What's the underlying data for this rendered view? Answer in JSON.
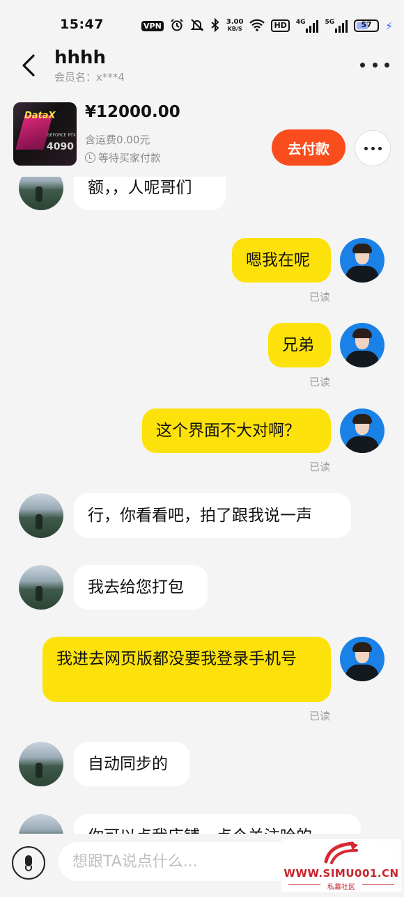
{
  "status_bar": {
    "time": "15:47",
    "vpn": "VPN",
    "speed_value": "3.00",
    "speed_unit": "KB/S",
    "hd": "HD",
    "net1": "4G",
    "net2": "5G",
    "battery": "57"
  },
  "header": {
    "title": "hhhh",
    "subtitle": "会员名：x***4"
  },
  "product": {
    "thumb_brand": "DataX",
    "thumb_gpu_text": "GEFORCE RTX",
    "thumb_model": "4090",
    "price": "¥12000.00",
    "shipping": "含运费0.00元",
    "status": "等待买家付款",
    "pay_button": "去付款"
  },
  "messages": [
    {
      "side": "left",
      "text": "额，，人呢哥们"
    },
    {
      "side": "right",
      "text": "嗯我在呢",
      "read": "已读"
    },
    {
      "side": "right",
      "text": "兄弟",
      "read": "已读"
    },
    {
      "side": "right",
      "text": "这个界面不大对啊？",
      "read": "已读"
    },
    {
      "side": "left",
      "text": "行，你看看吧，拍了跟我说一声"
    },
    {
      "side": "left",
      "text": "我去给您打包"
    },
    {
      "side": "right",
      "text": "我进去网页版都没要我登录手机号",
      "read": "已读"
    },
    {
      "side": "left",
      "text": "自动同步的"
    },
    {
      "side": "left",
      "text": "你可以点我店铺，点个关注哈的"
    }
  ],
  "input": {
    "placeholder": "想跟TA说点什么..."
  },
  "watermark": {
    "url": "WWW.SIMU001.CN",
    "name": "私募社区"
  },
  "colors": {
    "pay_button": "#fa4d1e",
    "my_bubble": "#fce20a",
    "their_bubble": "#ffffff",
    "background": "#f4f4f4"
  }
}
